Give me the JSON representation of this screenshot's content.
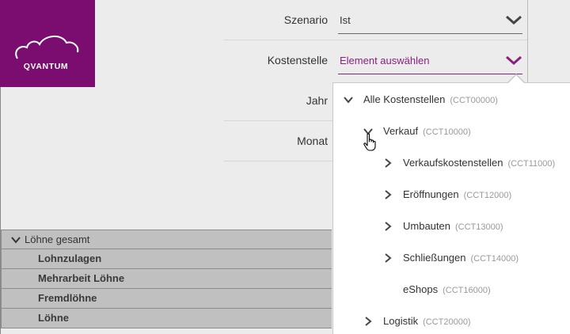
{
  "brand": {
    "logo_text": "QVANTUM",
    "color": "#7a0d6f"
  },
  "filters": [
    {
      "label": "Szenario",
      "value": "Ist"
    },
    {
      "label": "Kostenstelle",
      "value": "Element auswählen"
    },
    {
      "label": "Jahr"
    },
    {
      "label": "Monat"
    }
  ],
  "dropdown": {
    "items": [
      {
        "name": "Alle Kostenstellen",
        "code": "(CCT00000)",
        "state": "expanded"
      },
      {
        "name": "Verkauf",
        "code": "(CCT10000)",
        "state": "expanded"
      },
      {
        "name": "Verkaufskostenstellen",
        "code": "(CCT11000)",
        "state": "collapsed"
      },
      {
        "name": "Eröffnungen",
        "code": "(CCT12000)",
        "state": "collapsed"
      },
      {
        "name": "Umbauten",
        "code": "(CCT13000)",
        "state": "collapsed"
      },
      {
        "name": "Schließungen",
        "code": "(CCT14000)",
        "state": "collapsed"
      },
      {
        "name": "eShops",
        "code": "(CCT16000)",
        "state": "leaf"
      },
      {
        "name": "Logistik",
        "code": "(CCT20000)",
        "state": "collapsed"
      }
    ]
  },
  "groups": {
    "header": "Löhne gesamt",
    "items": [
      "Lohnzulagen",
      "Mehrarbeit Löhne",
      "Fremdlöhne",
      "Löhne"
    ]
  },
  "colors": {
    "accent": "#8a1f80"
  }
}
